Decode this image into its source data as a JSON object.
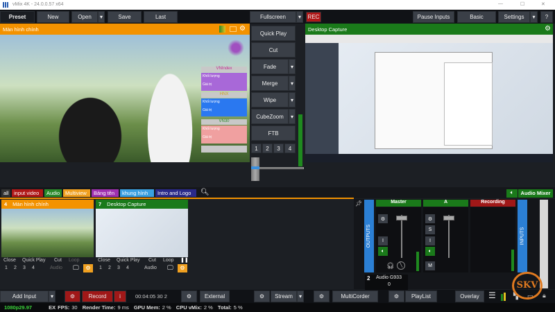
{
  "window": {
    "title": "vMix 4K - 24.0.0.57 x64",
    "minimize": "—",
    "maximize": "☐",
    "close": "✕"
  },
  "toolbar": {
    "preset": "Preset",
    "new": "New",
    "open": "Open",
    "save": "Save",
    "last": "Last",
    "fullscreen": "Fullscreen",
    "rec": "REC",
    "pause_inputs": "Pause Inputs",
    "basic": "Basic",
    "settings": "Settings",
    "help": "?",
    "dropdown": "▾"
  },
  "preview": {
    "title": "Màn hình chính",
    "overlays": [
      {
        "header": "VNIndex",
        "l1": "Khối lượng",
        "l2": "Giá trị"
      },
      {
        "header": "HNX",
        "l1": "Khối lượng",
        "l2": "Giá trị"
      },
      {
        "header": "VN30",
        "l1": "Khối lượng",
        "l2": "Giá trị"
      }
    ]
  },
  "output": {
    "title": "Desktop Capture"
  },
  "transitions": {
    "items": [
      "Quick Play",
      "Cut",
      "Fade",
      "Merge",
      "Wipe",
      "CubeZoom",
      "FTB"
    ],
    "numbers": [
      "1",
      "2",
      "3",
      "4"
    ]
  },
  "tabs": [
    "all",
    "input video",
    "Audio",
    "Multiview",
    "Bảng tên",
    "khung hình",
    "Intro and Logo"
  ],
  "tab_colors": [
    "#333",
    "#b01818",
    "#2a8a2a",
    "#f0a020",
    "#a030b0",
    "#3aa0e0",
    "#2a2a8a"
  ],
  "inputs": [
    {
      "number": "4",
      "title": "Màn hình chính",
      "color": "#f39200",
      "close": "Close",
      "quick_play": "Quick Play",
      "cut": "Cut",
      "loop": "Loop",
      "nums": [
        "1",
        "2",
        "3",
        "4"
      ],
      "audio": "Audio"
    },
    {
      "number": "7",
      "title": "Desktop Capture",
      "color": "#1a7a1a",
      "close": "Close",
      "quick_play": "Quick Play",
      "cut": "Cut",
      "loop": "Loop",
      "nums": [
        "1",
        "2",
        "3",
        "4"
      ],
      "audio": "Audio"
    }
  ],
  "audio_mixer": {
    "label": "Audio Mixer",
    "outputs": "OUTPUTS",
    "inputs": "INPUTS",
    "master": "Master",
    "bus_a": "A",
    "recording": "Recording",
    "s": "S",
    "i": "I",
    "m": "M",
    "input_number": "2",
    "input_name": "Audio G933",
    "input_value": "0"
  },
  "bottom": {
    "add_input": "Add Input",
    "record": "Record",
    "record_info": "i",
    "timecode": "00:04:05 30 2",
    "external": "External",
    "stream": "Stream",
    "multicorder": "MultiCorder",
    "playlist": "PlayList",
    "overlay": "Overlay"
  },
  "status": {
    "format": "1080p29.97",
    "ex": "EX",
    "fps_label": "FPS:",
    "fps": "30",
    "render_label": "Render Time:",
    "render": "9 ms",
    "gpu_label": "GPU Mem:",
    "gpu": "2 %",
    "cpu_label": "CPU vMix:",
    "cpu": "2 %",
    "total_label": "Total:",
    "total": "5 %"
  },
  "watermark": "SKV"
}
